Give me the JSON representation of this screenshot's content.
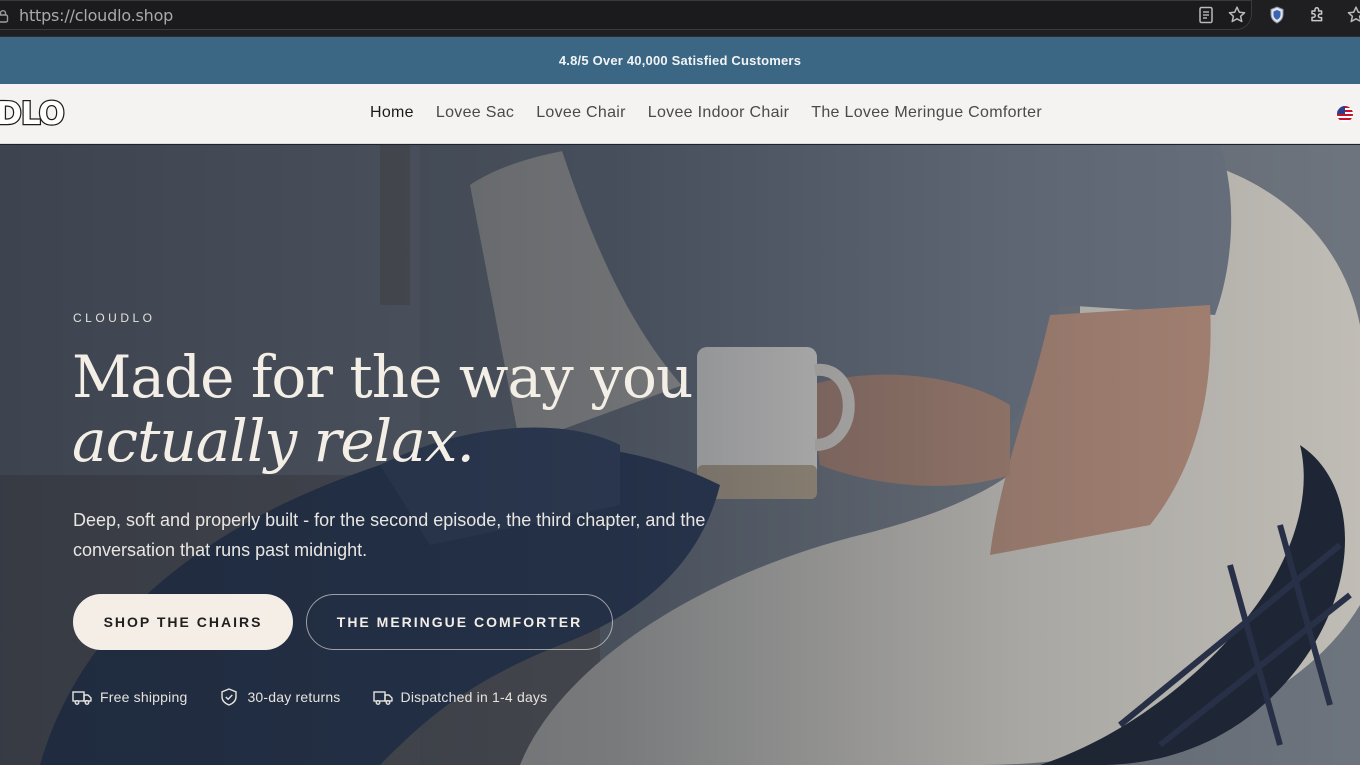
{
  "browser": {
    "url": "https://cloudlo.shop",
    "icons": [
      "lock-icon",
      "reader-mode-icon",
      "bookmark-star-icon",
      "shield-extension-icon",
      "puzzle-extension-icon",
      "favorites-icon"
    ]
  },
  "announcement": {
    "text": "4.8/5 Over 40,000 Satisfied Customers"
  },
  "header": {
    "logo_text": "UDLO",
    "nav": [
      {
        "label": "Home",
        "active": true
      },
      {
        "label": "Lovee Sac",
        "active": false
      },
      {
        "label": "Lovee Chair",
        "active": false
      },
      {
        "label": "Lovee Indoor Chair",
        "active": false
      },
      {
        "label": "The Lovee Meringue Comforter",
        "active": false
      }
    ],
    "locale_icon": "us-flag-icon"
  },
  "hero": {
    "eyebrow": "CLOUDLO",
    "headline_line1": "Made for the way you",
    "headline_line2": "actually relax.",
    "subtext": "Deep, soft and properly built - for the second episode, the third chapter, and the conversation that runs past midnight.",
    "primary_cta": "SHOP THE CHAIRS",
    "secondary_cta": "THE MERINGUE COMFORTER",
    "perks": [
      {
        "icon": "truck-icon",
        "label": "Free shipping"
      },
      {
        "icon": "shield-check-icon",
        "label": "30-day returns"
      },
      {
        "icon": "truck-icon",
        "label": "Dispatched in 1-4 days"
      }
    ]
  },
  "colors": {
    "announcement_bg": "#3b6785",
    "header_bg": "#f4f3f1",
    "cta_primary_bg": "#f4eee6",
    "hero_text": "#f4efe6"
  }
}
